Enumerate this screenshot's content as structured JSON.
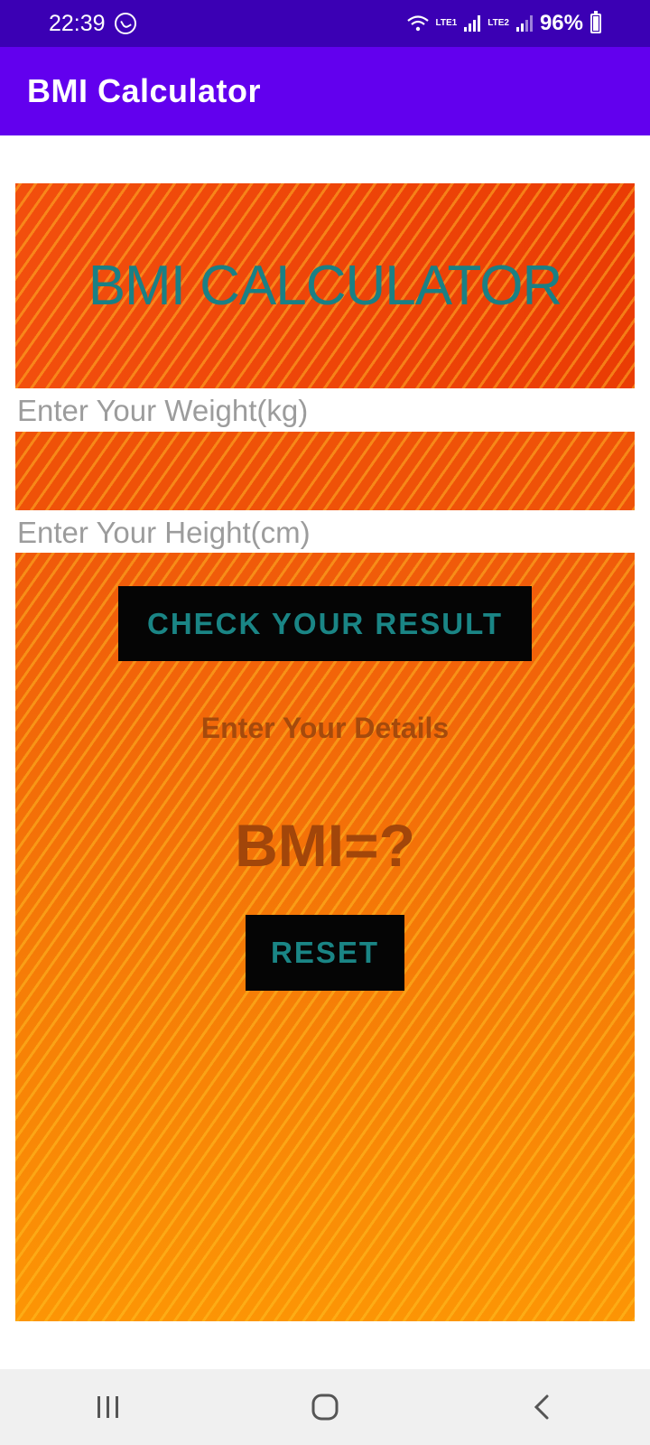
{
  "status_bar": {
    "time": "22:39",
    "lte1": "LTE1",
    "lte2": "LTE2",
    "battery": "96%"
  },
  "app_bar": {
    "title": "BMI Calculator"
  },
  "banner": {
    "title": "BMI CALCULATOR"
  },
  "form": {
    "weight_placeholder": "Enter Your Weight(kg)",
    "height_placeholder": "Enter Your Height(cm)",
    "check_label": "CHECK YOUR RESULT",
    "details_text": "Enter Your Details",
    "bmi_text": "BMI=?",
    "reset_label": "RESET"
  },
  "colors": {
    "status_bar": "#3b00b4",
    "app_bar": "#6200ee",
    "banner_text": "#1a8085",
    "button_bg": "#050505",
    "button_text": "#1a8585"
  },
  "icons": {
    "whatsapp": "whatsapp-icon",
    "wifi": "wifi-icon",
    "signal": "signal-icon",
    "battery": "battery-icon",
    "recents": "recents-icon",
    "home": "home-icon",
    "back": "back-icon"
  }
}
